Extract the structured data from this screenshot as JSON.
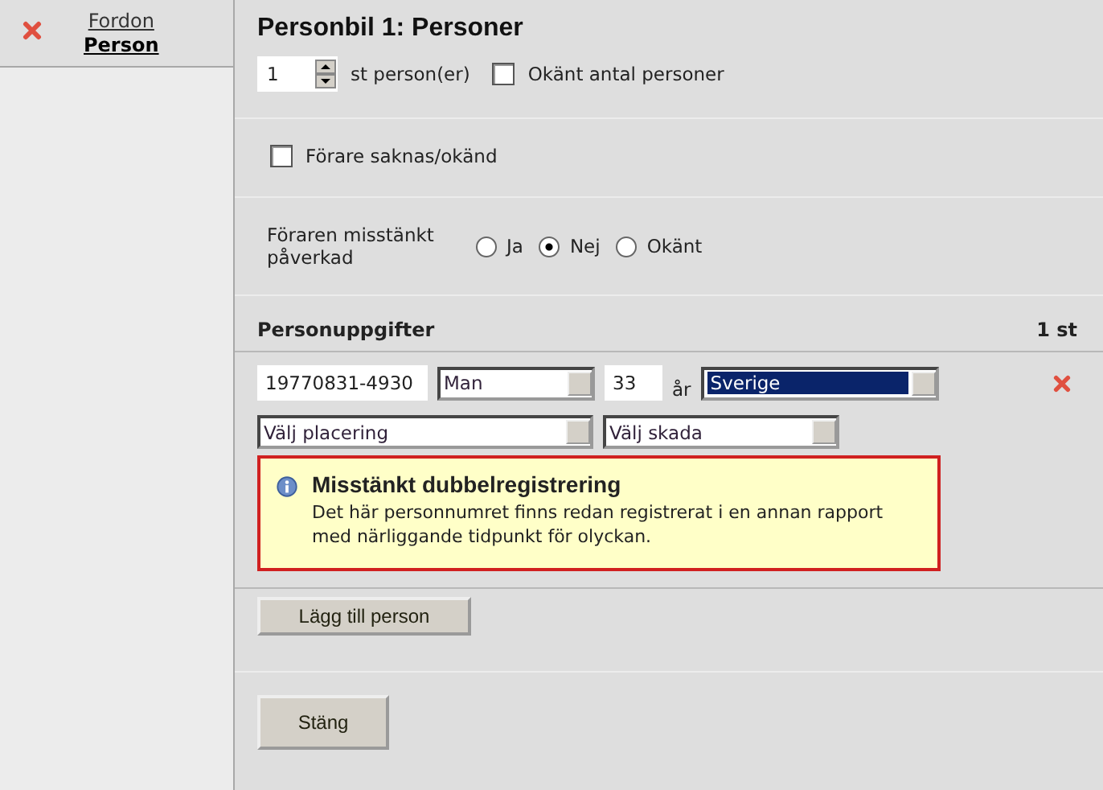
{
  "sidebar": {
    "items": [
      {
        "label": "Fordon",
        "selected": false
      },
      {
        "label": "Person",
        "selected": true
      }
    ]
  },
  "title": "Personbil 1: Personer",
  "count": {
    "value": "1",
    "unit": "st person(er)"
  },
  "unknown_count": {
    "label": "Okänt antal personer",
    "checked": false
  },
  "driver_missing": {
    "label": "Förare saknas/okänd",
    "checked": false
  },
  "influenced": {
    "label": "Föraren misstänkt påverkad",
    "options": [
      {
        "label": "Ja",
        "selected": false
      },
      {
        "label": "Nej",
        "selected": true
      },
      {
        "label": "Okänt",
        "selected": false
      }
    ]
  },
  "persons": {
    "title": "Personuppgifter",
    "count": "1 st",
    "rows": [
      {
        "id_number": "19770831-4930",
        "gender": "Man",
        "age": "33",
        "age_unit": "år",
        "country": "Sverige",
        "country_focused": true,
        "placement": "Välj placering",
        "injury": "Välj skada"
      }
    ]
  },
  "alert": {
    "title": "Misstänkt dubbelregistrering",
    "message": "Det här personnumret finns redan registrerat i en annan rapport med närliggande tidpunkt för olyckan."
  },
  "add_button": "Lägg till person",
  "close_button": "Stäng"
}
